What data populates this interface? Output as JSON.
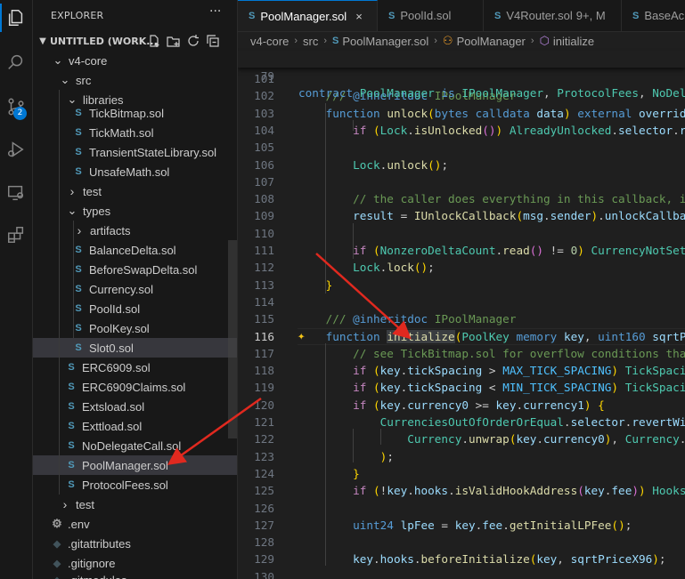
{
  "explorer": {
    "title": "EXPLORER",
    "more": "···",
    "workspace": "UNTITLED (WORK..."
  },
  "activity": {
    "scm_badge": "2"
  },
  "tree": [
    {
      "label": "v4-core",
      "type": "folder-open"
    },
    {
      "label": "src",
      "type": "folder-open"
    },
    {
      "label": "libraries",
      "type": "folder-open"
    },
    {
      "label": "TickBitmap.sol",
      "type": "sol"
    },
    {
      "label": "TickMath.sol",
      "type": "sol"
    },
    {
      "label": "TransientStateLibrary.sol",
      "type": "sol"
    },
    {
      "label": "UnsafeMath.sol",
      "type": "sol"
    },
    {
      "label": "test",
      "type": "folder"
    },
    {
      "label": "types",
      "type": "folder-open"
    },
    {
      "label": "artifacts",
      "type": "folder"
    },
    {
      "label": "BalanceDelta.sol",
      "type": "sol"
    },
    {
      "label": "BeforeSwapDelta.sol",
      "type": "sol"
    },
    {
      "label": "Currency.sol",
      "type": "sol"
    },
    {
      "label": "PoolId.sol",
      "type": "sol"
    },
    {
      "label": "PoolKey.sol",
      "type": "sol"
    },
    {
      "label": "Slot0.sol",
      "type": "sol"
    },
    {
      "label": "ERC6909.sol",
      "type": "sol"
    },
    {
      "label": "ERC6909Claims.sol",
      "type": "sol"
    },
    {
      "label": "Extsload.sol",
      "type": "sol"
    },
    {
      "label": "Exttload.sol",
      "type": "sol"
    },
    {
      "label": "NoDelegateCall.sol",
      "type": "sol"
    },
    {
      "label": "PoolManager.sol",
      "type": "sol"
    },
    {
      "label": "ProtocolFees.sol",
      "type": "sol"
    },
    {
      "label": "test",
      "type": "folder"
    },
    {
      "label": ".env",
      "type": "gear"
    },
    {
      "label": ".gitattributes",
      "type": "git"
    },
    {
      "label": ".gitignore",
      "type": "git"
    },
    {
      "label": ".gitmodules",
      "type": "git"
    }
  ],
  "tabs": [
    {
      "label": "PoolManager.sol",
      "close": "×",
      "modified": ""
    },
    {
      "label": "PoolId.sol",
      "close": "",
      "modified": ""
    },
    {
      "label": "V4Router.sol",
      "close": "",
      "modified": "9+, M"
    },
    {
      "label": "BaseAc",
      "close": "",
      "modified": ""
    }
  ],
  "breadcrumb": [
    "v4-core",
    "src",
    "PoolManager.sol",
    "PoolManager",
    "initialize"
  ],
  "sticky_line": {
    "number": "79",
    "text": "contract PoolManager is IPoolManager, ProtocolFees, NoDeleg"
  },
  "lines": [
    {
      "n": "101",
      "t": ""
    },
    {
      "n": "102",
      "t": "    /// @inheritdoc IPoolManager"
    },
    {
      "n": "103",
      "t": "    function unlock(bytes calldata data) external overrid"
    },
    {
      "n": "104",
      "t": "        if (Lock.isUnlocked()) AlreadyUnlocked.selector.r"
    },
    {
      "n": "105",
      "t": ""
    },
    {
      "n": "106",
      "t": "        Lock.unlock();"
    },
    {
      "n": "107",
      "t": ""
    },
    {
      "n": "108",
      "t": "        // the caller does everything in this callback, i"
    },
    {
      "n": "109",
      "t": "        result = IUnlockCallback(msg.sender).unlockCallba"
    },
    {
      "n": "110",
      "t": ""
    },
    {
      "n": "111",
      "t": "        if (NonzeroDeltaCount.read() != 0) CurrencyNotSet"
    },
    {
      "n": "112",
      "t": "        Lock.lock();"
    },
    {
      "n": "113",
      "t": "    }"
    },
    {
      "n": "114",
      "t": ""
    },
    {
      "n": "115",
      "t": "    /// @inheritdoc IPoolManager"
    },
    {
      "n": "116",
      "t": "    function initialize(PoolKey memory key, uint160 sqrtPr"
    },
    {
      "n": "117",
      "t": "        // see TickBitmap.sol for overflow conditions tha"
    },
    {
      "n": "118",
      "t": "        if (key.tickSpacing > MAX_TICK_SPACING) TickSpaci"
    },
    {
      "n": "119",
      "t": "        if (key.tickSpacing < MIN_TICK_SPACING) TickSpaci"
    },
    {
      "n": "120",
      "t": "        if (key.currency0 >= key.currency1) {"
    },
    {
      "n": "121",
      "t": "            CurrenciesOutOfOrderOrEqual.selector.revertWi"
    },
    {
      "n": "122",
      "t": "                Currency.unwrap(key.currency0), Currency."
    },
    {
      "n": "123",
      "t": "            );"
    },
    {
      "n": "124",
      "t": "        }"
    },
    {
      "n": "125",
      "t": "        if (!key.hooks.isValidHookAddress(key.fee)) Hooks"
    },
    {
      "n": "126",
      "t": ""
    },
    {
      "n": "127",
      "t": "        uint24 lpFee = key.fee.getInitialLPFee();"
    },
    {
      "n": "128",
      "t": ""
    },
    {
      "n": "129",
      "t": "        key.hooks.beforeInitialize(key, sqrtPriceX96);"
    },
    {
      "n": "130",
      "t": ""
    }
  ],
  "colors": {
    "accent": "#0078d4",
    "arrow": "#e0291f",
    "editor_bg": "#1f1f1f",
    "sidebar_bg": "#181818",
    "selection": "#37373d"
  }
}
